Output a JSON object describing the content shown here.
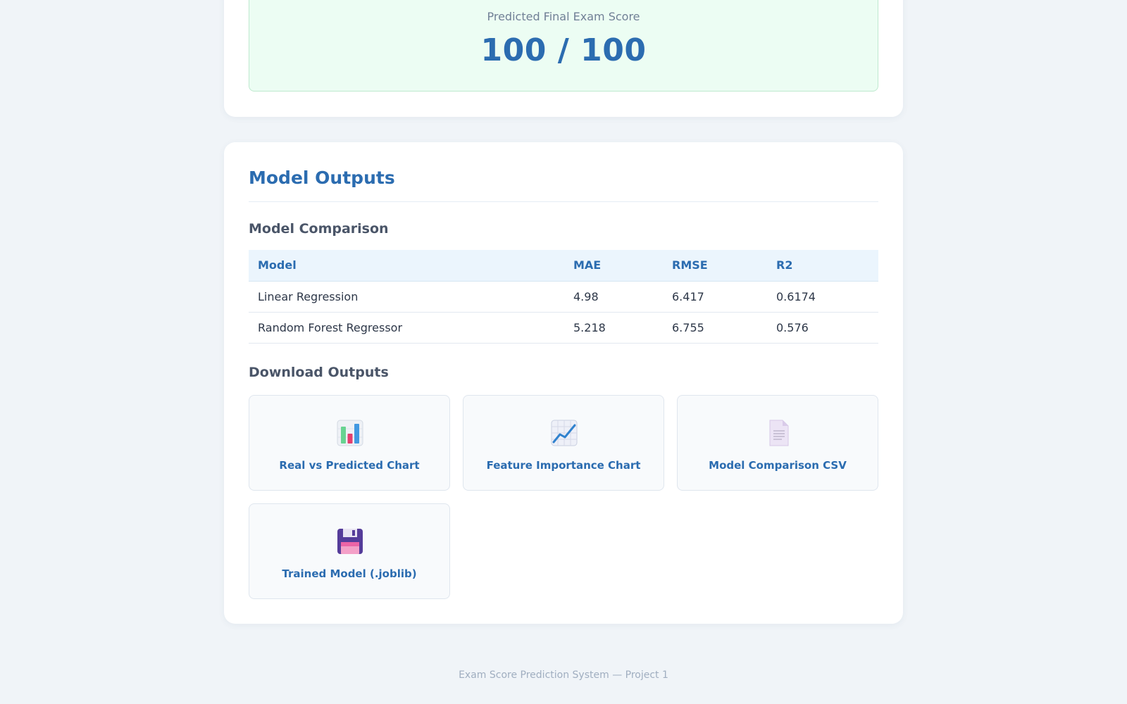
{
  "result": {
    "label": "Predicted Final Exam Score",
    "value": "100 / 100"
  },
  "outputs": {
    "title": "Model Outputs",
    "comparison_title": "Model Comparison",
    "table": {
      "headers": [
        "Model",
        "MAE",
        "RMSE",
        "R2"
      ],
      "rows": [
        [
          "Linear Regression",
          "4.98",
          "6.417",
          "0.6174"
        ],
        [
          "Random Forest Regressor",
          "5.218",
          "6.755",
          "0.576"
        ]
      ]
    },
    "download_title": "Download Outputs",
    "downloads": [
      {
        "label": "Real vs Predicted Chart",
        "icon": "bar-chart-icon"
      },
      {
        "label": "Feature Importance Chart",
        "icon": "line-chart-icon"
      },
      {
        "label": "Model Comparison CSV",
        "icon": "document-icon"
      },
      {
        "label": "Trained Model (.joblib)",
        "icon": "floppy-disk-icon"
      }
    ]
  },
  "footer": "Exam Score Prediction System — Project 1",
  "colors": {
    "accent": "#2b6cb0",
    "result_bg": "#ecfdf3",
    "page_bg": "#f0f4f8"
  }
}
